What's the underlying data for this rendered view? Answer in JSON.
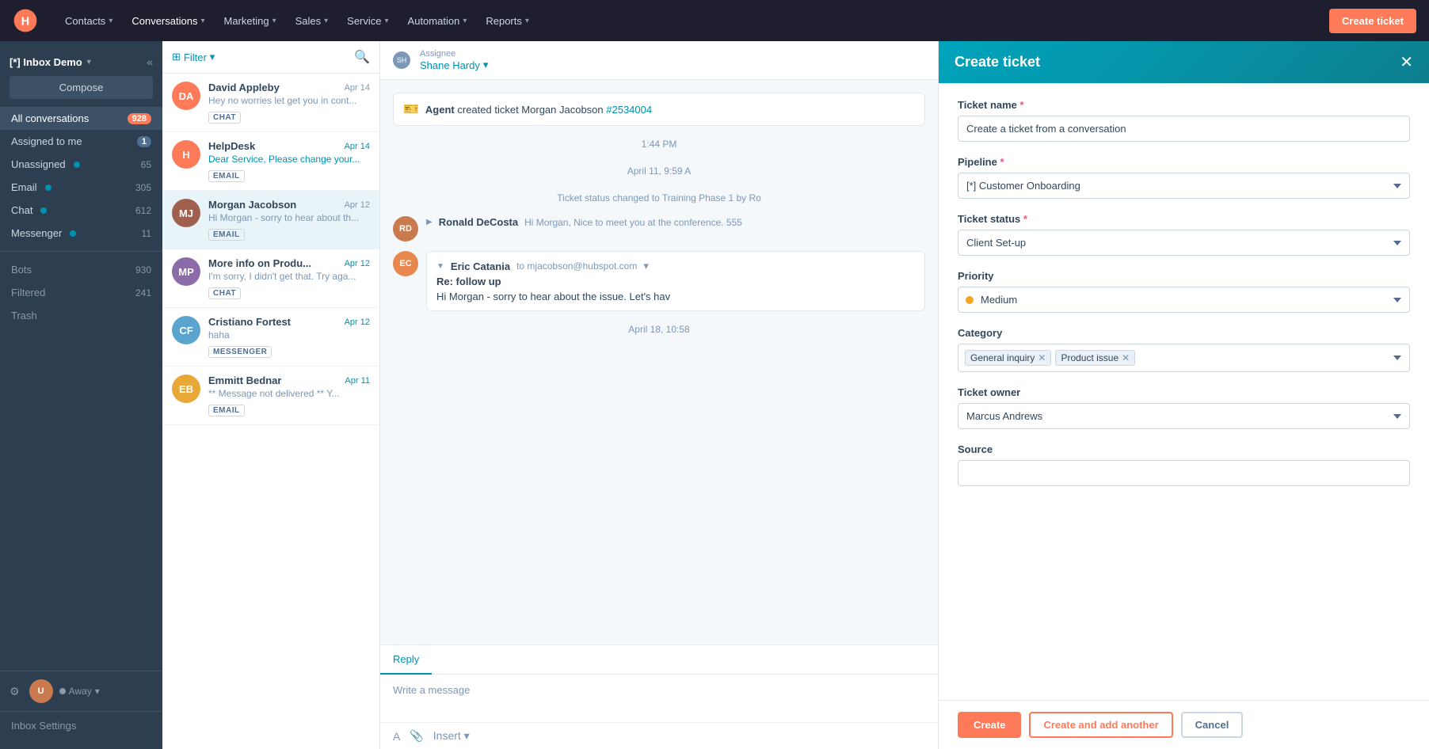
{
  "topnav": {
    "logo_text": "H",
    "items": [
      {
        "label": "Contacts",
        "id": "contacts"
      },
      {
        "label": "Conversations",
        "id": "conversations"
      },
      {
        "label": "Marketing",
        "id": "marketing"
      },
      {
        "label": "Sales",
        "id": "sales"
      },
      {
        "label": "Service",
        "id": "service"
      },
      {
        "label": "Automation",
        "id": "automation"
      },
      {
        "label": "Reports",
        "id": "reports"
      }
    ],
    "create_ticket_btn": "Create ticket"
  },
  "sidebar": {
    "inbox_label": "[*] Inbox Demo",
    "compose_btn": "Compose",
    "nav_items": [
      {
        "label": "All conversations",
        "count": "928",
        "count_style": "orange",
        "id": "all"
      },
      {
        "label": "Assigned to me",
        "count": "1",
        "count_style": "plain",
        "id": "assigned"
      },
      {
        "label": "Unassigned",
        "count": "65",
        "dot": true,
        "id": "unassigned"
      },
      {
        "label": "Email",
        "count": "305",
        "dot": true,
        "id": "email"
      },
      {
        "label": "Chat",
        "count": "612",
        "dot": true,
        "id": "chat"
      },
      {
        "label": "Messenger",
        "count": "11",
        "dot": true,
        "id": "messenger"
      }
    ],
    "extra_items": [
      {
        "label": "Bots",
        "count": "930"
      },
      {
        "label": "Filtered",
        "count": "241"
      },
      {
        "label": "Trash",
        "count": ""
      }
    ],
    "user_status": "Away",
    "settings_label": "Inbox Settings"
  },
  "conv_list": {
    "filter_label": "Filter",
    "conversations": [
      {
        "id": "1",
        "name": "David Appleby",
        "date": "Apr 14",
        "preview": "Hey no worries let get you in cont...",
        "badge": "CHAT",
        "avatar_color": "#ff7a59",
        "avatar_initials": "DA"
      },
      {
        "id": "2",
        "name": "HelpDesk",
        "date": "Apr 14",
        "date_blue": true,
        "preview": "Dear Service, Please change your...",
        "badge": "EMAIL",
        "avatar_color": "#ff7a59",
        "avatar_initials": "H"
      },
      {
        "id": "3",
        "name": "Morgan Jacobson",
        "date": "Apr 12",
        "preview": "Hi Morgan - sorry to hear about th...",
        "badge": "EMAIL",
        "avatar_color": "#a06050",
        "avatar_initials": "MJ",
        "active": true
      },
      {
        "id": "4",
        "name": "More info on Produ...",
        "date": "Apr 12",
        "date_blue": true,
        "preview": "I'm sorry, I didn't get that. Try aga...",
        "badge": "CHAT",
        "avatar_color": "#8b6ba8",
        "avatar_initials": "MP"
      },
      {
        "id": "5",
        "name": "Cristiano Fortest",
        "date": "Apr 12",
        "date_blue": true,
        "preview": "haha",
        "badge": "MESSENGER",
        "avatar_color": "#5ba4cf",
        "avatar_initials": "CF"
      },
      {
        "id": "6",
        "name": "Emmitt Bednar",
        "date": "Apr 11",
        "date_blue": true,
        "preview": "** Message not delivered ** Y...",
        "badge": "EMAIL",
        "avatar_color": "#e8a838",
        "avatar_initials": "EB"
      }
    ]
  },
  "conv_view": {
    "assignee_label": "Assignee",
    "assignee_name": "Shane Hardy",
    "messages": [
      {
        "type": "ticket",
        "text": "Agent created ticket Morgan Jacobson ",
        "ticket_num": "#2534004",
        "time": "1:44 PM"
      },
      {
        "type": "status",
        "text": "Ticket status changed to Training Phase 1 by Ro",
        "time": "April 11, 9:59 A"
      },
      {
        "type": "message",
        "sender": "Ronald DeCosta",
        "preview": "Hi Morgan, Nice to meet you at the conference. 555",
        "avatar_color": "#c97a4e",
        "avatar_initials": "RD"
      },
      {
        "type": "email",
        "sender": "Eric Catania",
        "to": "to mjacobson@hubspot.com",
        "subject": "Re: follow up",
        "preview": "Hi Morgan - sorry to hear about the issue. Let's hav",
        "avatar_color": "#e8884e",
        "avatar_initials": "EC",
        "time": "April 18, 10:58"
      }
    ],
    "reply_tab": "Reply",
    "reply_placeholder": "Write a message",
    "toolbar": {
      "font_icon": "A",
      "attach_icon": "📎",
      "insert_label": "Insert"
    }
  },
  "create_ticket_panel": {
    "title": "Create ticket",
    "close_icon": "✕",
    "fields": {
      "ticket_name_label": "Ticket name",
      "ticket_name_value": "Create a ticket from a conversation",
      "pipeline_label": "Pipeline",
      "pipeline_value": "[*] Customer Onboarding",
      "ticket_status_label": "Ticket status",
      "ticket_status_value": "Client Set-up",
      "priority_label": "Priority",
      "priority_value": "Medium",
      "category_label": "Category",
      "category_tags": [
        "General inquiry",
        "Product issue"
      ],
      "ticket_owner_label": "Ticket owner",
      "ticket_owner_value": "Marcus Andrews",
      "source_label": "Source"
    },
    "footer": {
      "create_btn": "Create",
      "create_another_btn": "Create and add another",
      "cancel_btn": "Cancel"
    }
  }
}
